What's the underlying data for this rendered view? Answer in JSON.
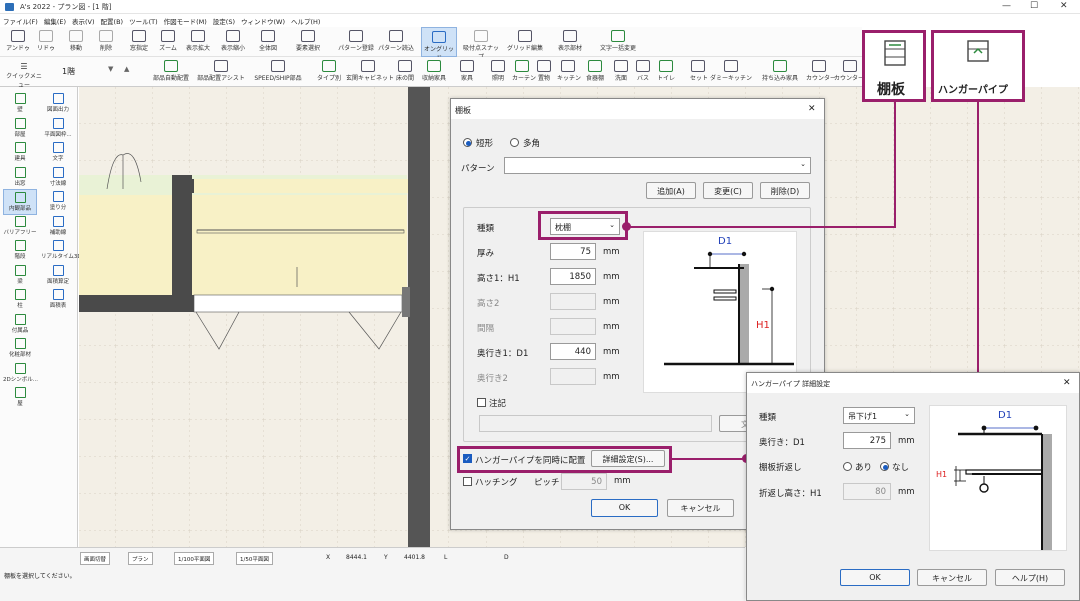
{
  "window": {
    "title": "A's 2022 - プラン図 - [1 階]",
    "minimize": "—",
    "maximize": "☐",
    "close": "✕"
  },
  "menu": [
    "ファイル(F)",
    "編集(E)",
    "表示(V)",
    "配置(B)",
    "ツール(T)",
    "作図モード(M)",
    "設定(S)",
    "ウィンドウ(W)",
    "ヘルプ(H)"
  ],
  "toolbar1": [
    "アンドゥ",
    "リドゥ",
    "移動",
    "削除",
    "窓指定",
    "ズーム",
    "表示拡大",
    "表示縮小",
    "全体図",
    "要素選択",
    "パターン登録",
    "パターン読込",
    "オングリッド",
    "吸付点スナップ",
    "グリッド編集",
    "表示部材",
    "文字一括変更"
  ],
  "toolbar2": {
    "quick": "クイックメニュー",
    "floor": "1階",
    "items": [
      "部品自動配置",
      "部品配置アシスト",
      "SPEED/SHIP部品",
      "タイプ別",
      "玄関キャビネット",
      "床の間",
      "収納家具",
      "家具",
      "照明",
      "カーテン",
      "置物",
      "キッチン",
      "食器棚",
      "洗面",
      "バス",
      "トイレ",
      "セット",
      "ダミーキッチン",
      "持ち込み家具",
      "カウンター",
      "カウンター角天"
    ]
  },
  "left_panel": [
    [
      "壁",
      "図面出力"
    ],
    [
      "部屋",
      "平面図枠..."
    ],
    [
      "建具",
      "文字"
    ],
    [
      "出窓",
      "寸法線"
    ],
    [
      "内観部品",
      "塗り分"
    ],
    [
      "バリアフリー",
      "補助線"
    ],
    [
      "階段",
      "リアルタイム3D..."
    ],
    [
      "梁",
      "面積算定"
    ],
    [
      "柱",
      "面積表"
    ],
    [
      "付属品",
      ""
    ],
    [
      "化粧部材",
      ""
    ],
    [
      "2Dシンボル...",
      ""
    ],
    [
      "屋",
      ""
    ]
  ],
  "status": {
    "buttons": [
      "画面切替",
      "プラン",
      "1/100平面図",
      "1/50平面図"
    ],
    "x_label": "X",
    "x": "8444.1",
    "y_label": "Y",
    "y": "4401.8",
    "l_label": "L",
    "d_label": "D",
    "message": "棚板を選択してください。"
  },
  "dialog": {
    "title": "棚板",
    "close": "✕",
    "shape_rect": "短形",
    "shape_poly": "多角",
    "pattern_label": "パターン",
    "add": "追加(A)",
    "change": "変更(C)",
    "delete": "削除(D)",
    "kind_label": "種類",
    "kind_value": "枕棚",
    "thickness_label": "厚み",
    "thickness": "75",
    "unit": "mm",
    "height1_label": "高さ1：H1",
    "height1": "1850",
    "height2_label": "高さ2",
    "spacing_label": "間隔",
    "depth1_label": "奥行き1：D1",
    "depth1": "440",
    "depth2_label": "奥行き2",
    "note_label": "注記",
    "text_btn": "文字",
    "hanger_check": "ハンガーパイプを同時に配置",
    "detail_btn": "詳細設定(S)...",
    "hatching_label": "ハッチング",
    "pitch_label": "ピッチ",
    "pitch": "50",
    "ok": "OK",
    "cancel": "キャンセル",
    "fig_d1": "D1",
    "fig_h1": "H1"
  },
  "dialog2": {
    "title": "ハンガーパイプ 詳細設定",
    "close": "✕",
    "kind_label": "種類",
    "kind_value": "吊下げ1",
    "depth_label": "奥行き：D1",
    "depth": "275",
    "unit": "mm",
    "fold_label": "棚板折返し",
    "fold_yes": "あり",
    "fold_no": "なし",
    "fold_height_label": "折返し高さ：H1",
    "fold_height": "80",
    "ok": "OK",
    "cancel": "キャンセル",
    "help": "ヘルプ(H)",
    "fig_d1": "D1",
    "fig_h1": "H1"
  },
  "callouts": {
    "shelf": "棚板",
    "hanger": "ハンガーパイプ"
  },
  "colors": {
    "accent": "#9a1f6b",
    "selected": "#cfe2f7",
    "highlight_blue": "#1a5cc0",
    "fig_red": "#d22",
    "fig_blue": "#1f3fb8"
  }
}
